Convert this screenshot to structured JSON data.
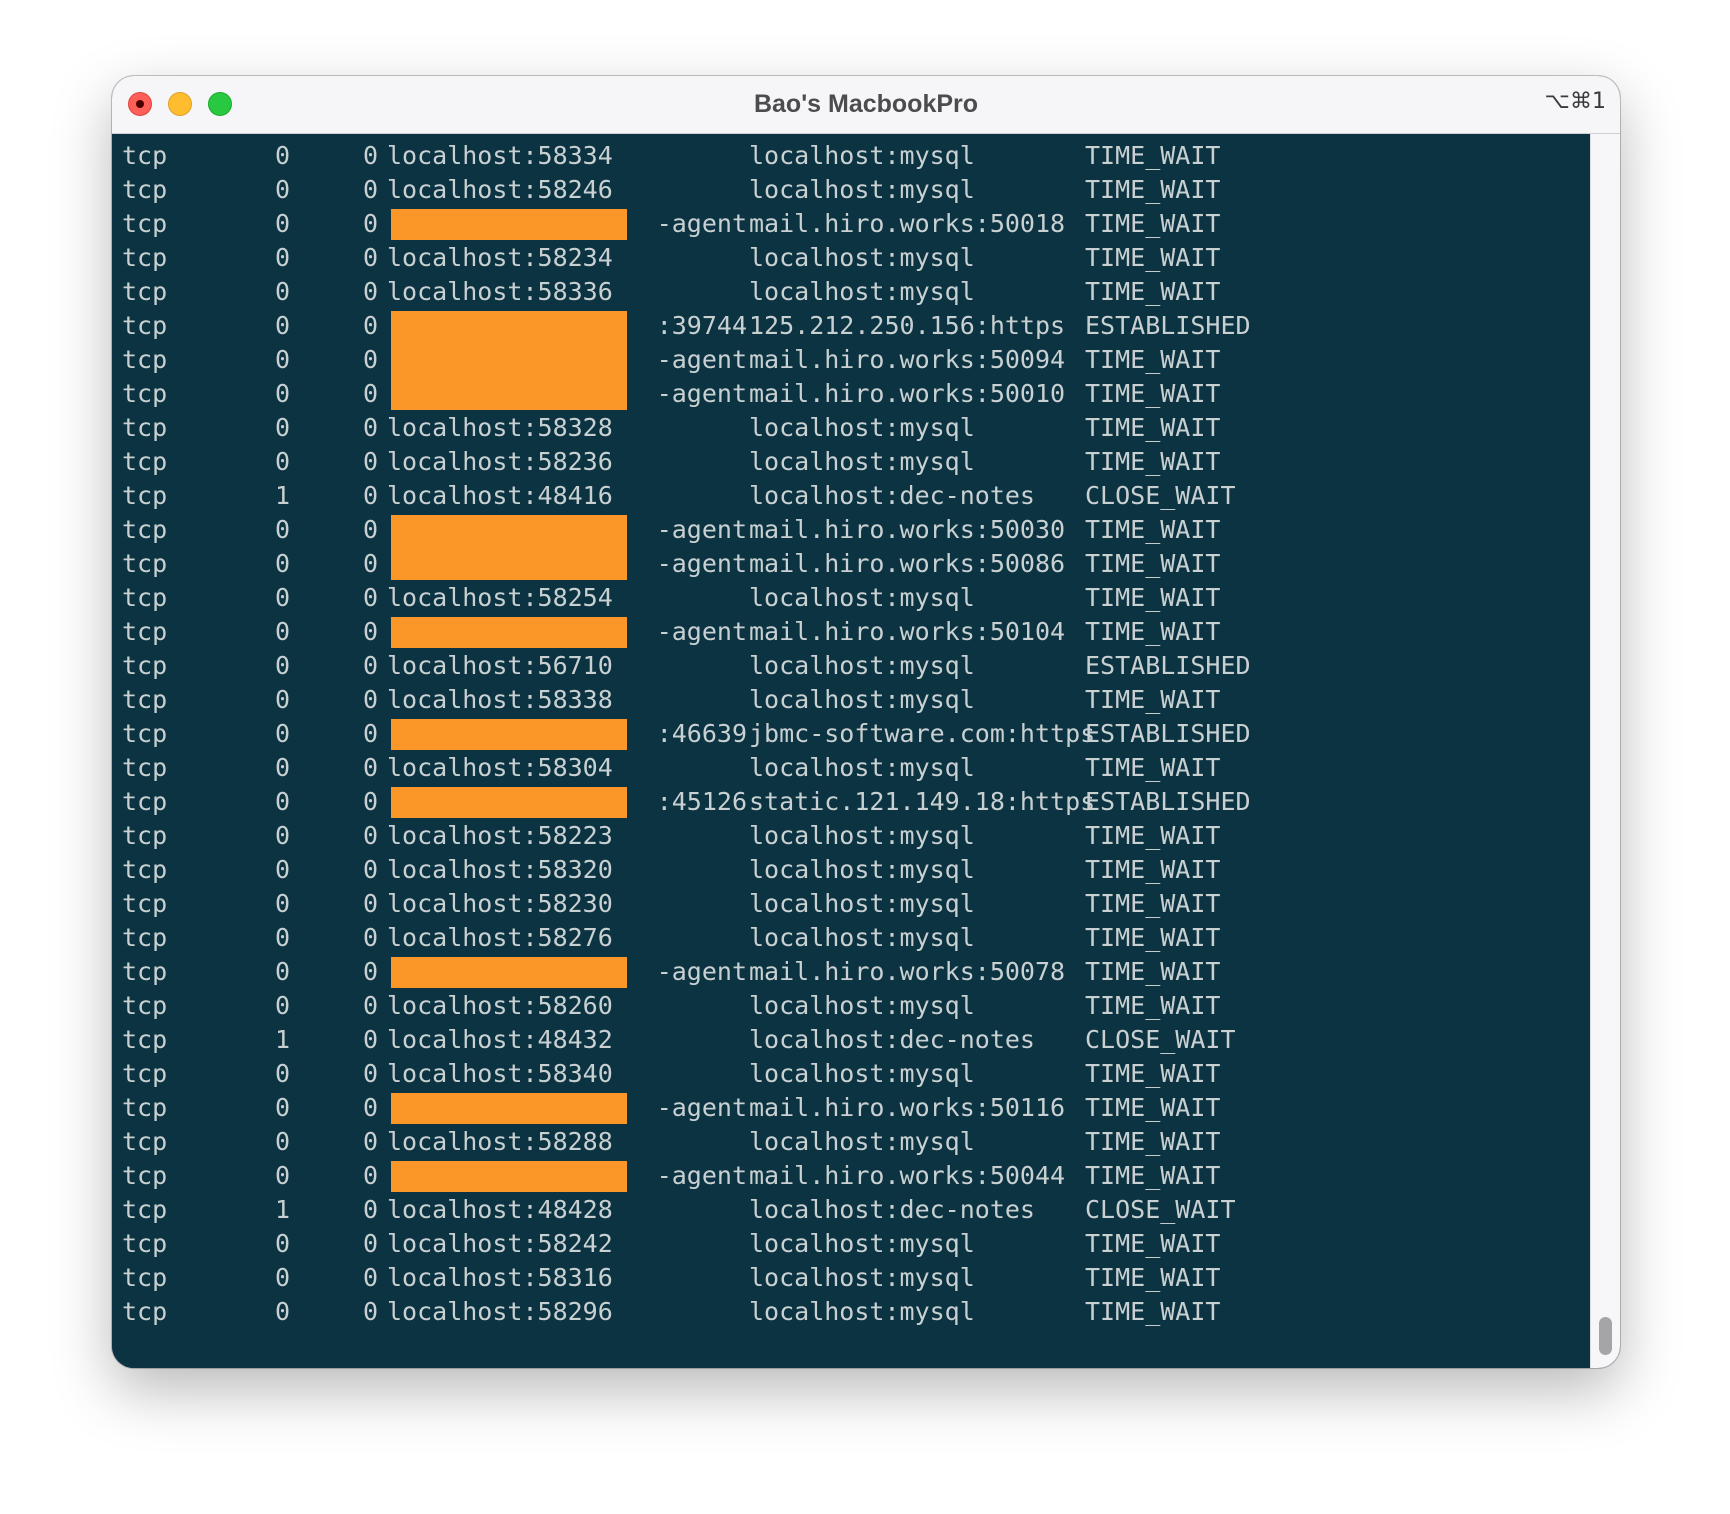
{
  "window": {
    "title": "Bao's MacbookPro",
    "shortcut": "⌥⌘1"
  },
  "colors": {
    "terminal_bg": "#0b3341",
    "terminal_fg": "#c9d0d2",
    "redaction": "#fb9628"
  },
  "rows": [
    {
      "proto": "tcp",
      "recv": "0",
      "send": "0",
      "local": "localhost:58334",
      "local_redacted": false,
      "local_suffix": "",
      "foreign": "localhost:mysql",
      "state": "TIME_WAIT"
    },
    {
      "proto": "tcp",
      "recv": "0",
      "send": "0",
      "local": "localhost:58246",
      "local_redacted": false,
      "local_suffix": "",
      "foreign": "localhost:mysql",
      "state": "TIME_WAIT"
    },
    {
      "proto": "tcp",
      "recv": "0",
      "send": "0",
      "local": "",
      "local_redacted": true,
      "local_suffix": "-agent",
      "foreign": "mail.hiro.works:50018",
      "state": "TIME_WAIT"
    },
    {
      "proto": "tcp",
      "recv": "0",
      "send": "0",
      "local": "localhost:58234",
      "local_redacted": false,
      "local_suffix": "",
      "foreign": "localhost:mysql",
      "state": "TIME_WAIT"
    },
    {
      "proto": "tcp",
      "recv": "0",
      "send": "0",
      "local": "localhost:58336",
      "local_redacted": false,
      "local_suffix": "",
      "foreign": "localhost:mysql",
      "state": "TIME_WAIT"
    },
    {
      "proto": "tcp",
      "recv": "0",
      "send": "0",
      "local": "",
      "local_redacted": true,
      "local_suffix": ":39744",
      "foreign": "125.212.250.156:https",
      "state": "ESTABLISHED"
    },
    {
      "proto": "tcp",
      "recv": "0",
      "send": "0",
      "local": "",
      "local_redacted": true,
      "local_suffix": "-agent",
      "foreign": "mail.hiro.works:50094",
      "state": "TIME_WAIT"
    },
    {
      "proto": "tcp",
      "recv": "0",
      "send": "0",
      "local": "",
      "local_redacted": true,
      "local_suffix": "-agent",
      "foreign": "mail.hiro.works:50010",
      "state": "TIME_WAIT"
    },
    {
      "proto": "tcp",
      "recv": "0",
      "send": "0",
      "local": "localhost:58328",
      "local_redacted": false,
      "local_suffix": "",
      "foreign": "localhost:mysql",
      "state": "TIME_WAIT"
    },
    {
      "proto": "tcp",
      "recv": "0",
      "send": "0",
      "local": "localhost:58236",
      "local_redacted": false,
      "local_suffix": "",
      "foreign": "localhost:mysql",
      "state": "TIME_WAIT"
    },
    {
      "proto": "tcp",
      "recv": "1",
      "send": "0",
      "local": "localhost:48416",
      "local_redacted": false,
      "local_suffix": "",
      "foreign": "localhost:dec-notes",
      "state": "CLOSE_WAIT"
    },
    {
      "proto": "tcp",
      "recv": "0",
      "send": "0",
      "local": "",
      "local_redacted": true,
      "local_suffix": "-agent",
      "foreign": "mail.hiro.works:50030",
      "state": "TIME_WAIT"
    },
    {
      "proto": "tcp",
      "recv": "0",
      "send": "0",
      "local": "",
      "local_redacted": true,
      "local_suffix": "-agent",
      "foreign": "mail.hiro.works:50086",
      "state": "TIME_WAIT"
    },
    {
      "proto": "tcp",
      "recv": "0",
      "send": "0",
      "local": "localhost:58254",
      "local_redacted": false,
      "local_suffix": "",
      "foreign": "localhost:mysql",
      "state": "TIME_WAIT"
    },
    {
      "proto": "tcp",
      "recv": "0",
      "send": "0",
      "local": "",
      "local_redacted": true,
      "local_suffix": "-agent",
      "foreign": "mail.hiro.works:50104",
      "state": "TIME_WAIT"
    },
    {
      "proto": "tcp",
      "recv": "0",
      "send": "0",
      "local": "localhost:56710",
      "local_redacted": false,
      "local_suffix": "",
      "foreign": "localhost:mysql",
      "state": "ESTABLISHED"
    },
    {
      "proto": "tcp",
      "recv": "0",
      "send": "0",
      "local": "localhost:58338",
      "local_redacted": false,
      "local_suffix": "",
      "foreign": "localhost:mysql",
      "state": "TIME_WAIT"
    },
    {
      "proto": "tcp",
      "recv": "0",
      "send": "0",
      "local": "",
      "local_redacted": true,
      "local_suffix": ":46639",
      "foreign": "jbmc-software.com:https",
      "state": "ESTABLISHED"
    },
    {
      "proto": "tcp",
      "recv": "0",
      "send": "0",
      "local": "localhost:58304",
      "local_redacted": false,
      "local_suffix": "",
      "foreign": "localhost:mysql",
      "state": "TIME_WAIT"
    },
    {
      "proto": "tcp",
      "recv": "0",
      "send": "0",
      "local": "",
      "local_redacted": true,
      "local_suffix": ":45126",
      "foreign": "static.121.149.18:https",
      "state": "ESTABLISHED"
    },
    {
      "proto": "tcp",
      "recv": "0",
      "send": "0",
      "local": "localhost:58223",
      "local_redacted": false,
      "local_suffix": "",
      "foreign": "localhost:mysql",
      "state": "TIME_WAIT"
    },
    {
      "proto": "tcp",
      "recv": "0",
      "send": "0",
      "local": "localhost:58320",
      "local_redacted": false,
      "local_suffix": "",
      "foreign": "localhost:mysql",
      "state": "TIME_WAIT"
    },
    {
      "proto": "tcp",
      "recv": "0",
      "send": "0",
      "local": "localhost:58230",
      "local_redacted": false,
      "local_suffix": "",
      "foreign": "localhost:mysql",
      "state": "TIME_WAIT"
    },
    {
      "proto": "tcp",
      "recv": "0",
      "send": "0",
      "local": "localhost:58276",
      "local_redacted": false,
      "local_suffix": "",
      "foreign": "localhost:mysql",
      "state": "TIME_WAIT"
    },
    {
      "proto": "tcp",
      "recv": "0",
      "send": "0",
      "local": "",
      "local_redacted": true,
      "local_suffix": "-agent",
      "foreign": "mail.hiro.works:50078",
      "state": "TIME_WAIT"
    },
    {
      "proto": "tcp",
      "recv": "0",
      "send": "0",
      "local": "localhost:58260",
      "local_redacted": false,
      "local_suffix": "",
      "foreign": "localhost:mysql",
      "state": "TIME_WAIT"
    },
    {
      "proto": "tcp",
      "recv": "1",
      "send": "0",
      "local": "localhost:48432",
      "local_redacted": false,
      "local_suffix": "",
      "foreign": "localhost:dec-notes",
      "state": "CLOSE_WAIT"
    },
    {
      "proto": "tcp",
      "recv": "0",
      "send": "0",
      "local": "localhost:58340",
      "local_redacted": false,
      "local_suffix": "",
      "foreign": "localhost:mysql",
      "state": "TIME_WAIT"
    },
    {
      "proto": "tcp",
      "recv": "0",
      "send": "0",
      "local": "",
      "local_redacted": true,
      "local_suffix": "-agent",
      "foreign": "mail.hiro.works:50116",
      "state": "TIME_WAIT"
    },
    {
      "proto": "tcp",
      "recv": "0",
      "send": "0",
      "local": "localhost:58288",
      "local_redacted": false,
      "local_suffix": "",
      "foreign": "localhost:mysql",
      "state": "TIME_WAIT"
    },
    {
      "proto": "tcp",
      "recv": "0",
      "send": "0",
      "local": "",
      "local_redacted": true,
      "local_suffix": "-agent",
      "foreign": "mail.hiro.works:50044",
      "state": "TIME_WAIT"
    },
    {
      "proto": "tcp",
      "recv": "1",
      "send": "0",
      "local": "localhost:48428",
      "local_redacted": false,
      "local_suffix": "",
      "foreign": "localhost:dec-notes",
      "state": "CLOSE_WAIT"
    },
    {
      "proto": "tcp",
      "recv": "0",
      "send": "0",
      "local": "localhost:58242",
      "local_redacted": false,
      "local_suffix": "",
      "foreign": "localhost:mysql",
      "state": "TIME_WAIT"
    },
    {
      "proto": "tcp",
      "recv": "0",
      "send": "0",
      "local": "localhost:58316",
      "local_redacted": false,
      "local_suffix": "",
      "foreign": "localhost:mysql",
      "state": "TIME_WAIT"
    },
    {
      "proto": "tcp",
      "recv": "0",
      "send": "0",
      "local": "localhost:58296",
      "local_redacted": false,
      "local_suffix": "",
      "foreign": "localhost:mysql",
      "state": "TIME_WAIT"
    }
  ]
}
